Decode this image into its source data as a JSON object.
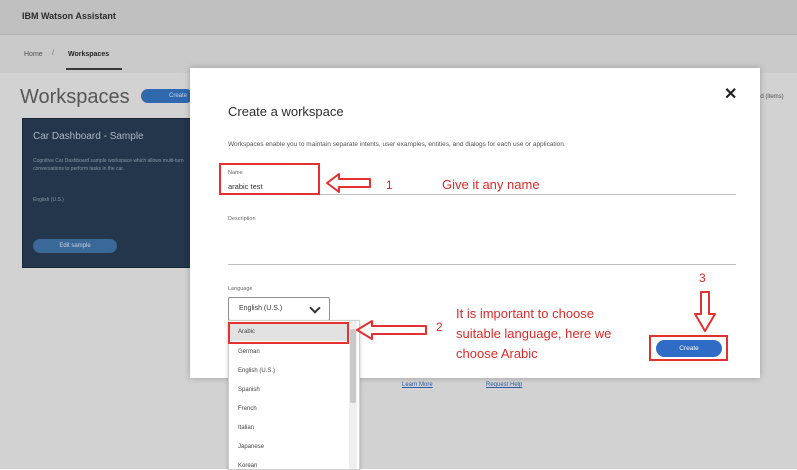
{
  "app": {
    "brand": "IBM Watson Assistant",
    "nav": {
      "home": "Home",
      "separator": "/",
      "workspaces": "Workspaces"
    },
    "page_title": "Workspaces",
    "create_button": "Create",
    "right_hint": "ed (items)"
  },
  "sample_card": {
    "title": "Car Dashboard - Sample",
    "description": "Cognitive Car Dashboard sample workspace which allows multi-turn conversations to perform tasks in the car.",
    "language": "English (U.S.)",
    "edit_button": "Edit sample"
  },
  "modal": {
    "title": "Create a workspace",
    "description": "Workspaces enable you to maintain separate intents, user examples, entities, and dialogs for each use or application.",
    "close_icon": "close-icon",
    "name_label": "Name",
    "name_value": "arabic test",
    "description_label": "Description",
    "language_label": "Language",
    "language_value": "English (U.S.)",
    "learn_more": "Learn More",
    "request_help": "Request Help",
    "create_button": "Create",
    "language_options": [
      "Arabic",
      "German",
      "English (U.S.)",
      "Spanish",
      "French",
      "Italian",
      "Japanese",
      "Korean"
    ],
    "selected_option": "Arabic"
  },
  "annotations": {
    "step1_number": "1",
    "step1_text": "Give it any name",
    "step2_number": "2",
    "step2_text_line1": "It is important to choose",
    "step2_text_line2": "suitable language, here we",
    "step2_text_line3": "choose Arabic",
    "step3_number": "3",
    "color": "#e33030"
  }
}
